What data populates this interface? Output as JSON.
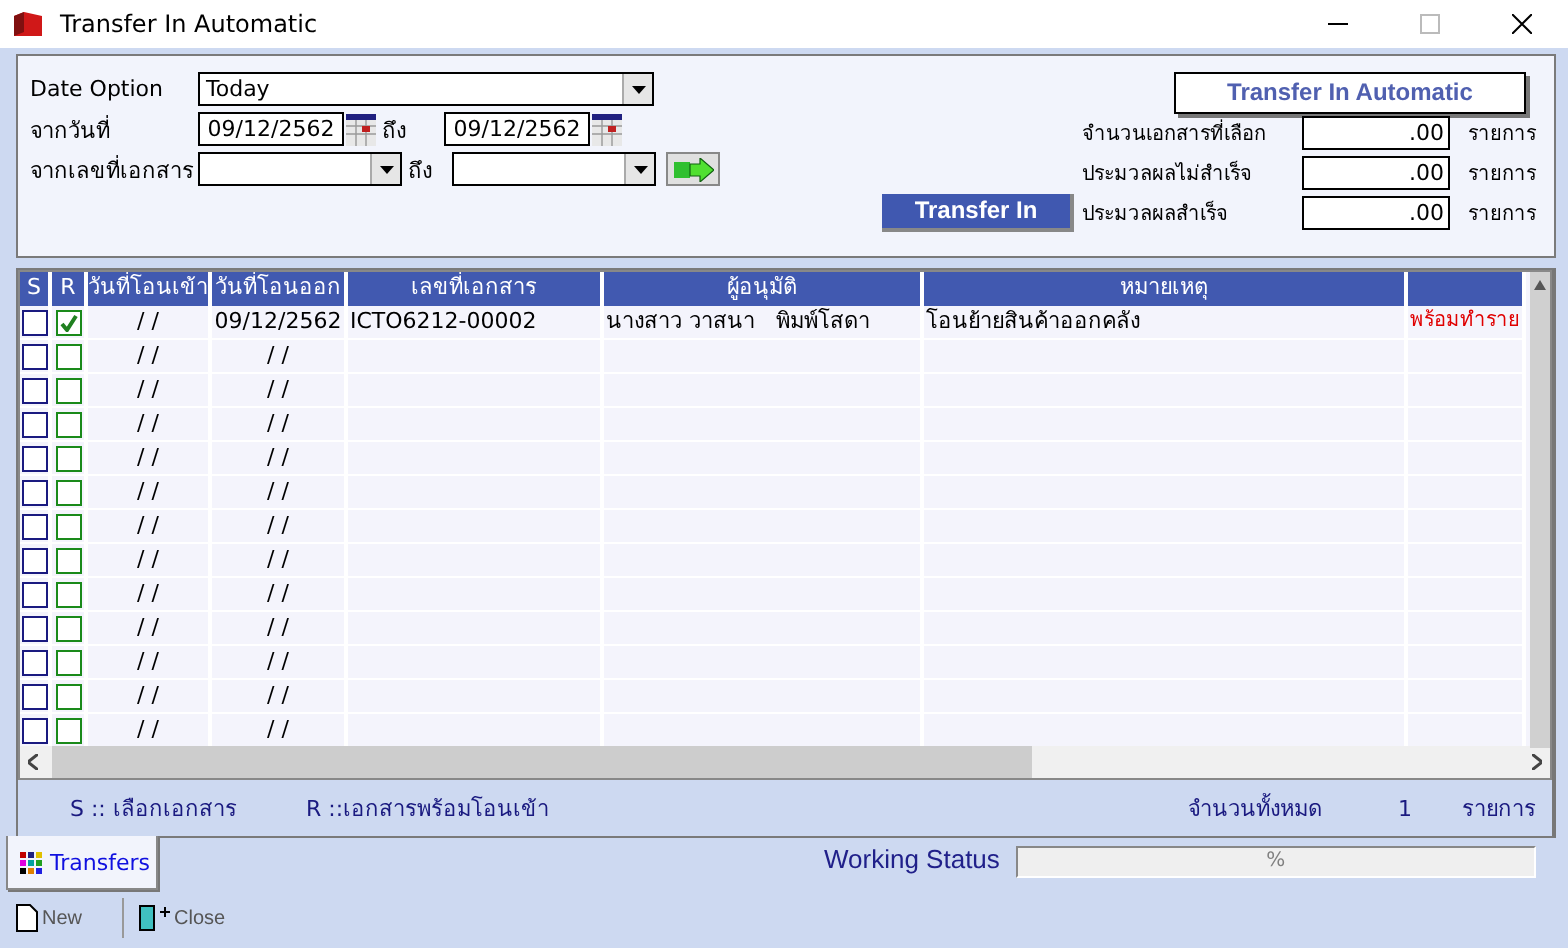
{
  "window": {
    "title": "Transfer In Automatic"
  },
  "filters": {
    "date_option": {
      "label": "Date Option",
      "value": "Today"
    },
    "date_range": {
      "label": "จากวันที่",
      "from": "09/12/2562",
      "to_label": "ถึง",
      "to": "09/12/2562"
    },
    "doc_range": {
      "label": "จากเลขที่เอกสาร",
      "to_label": "ถึง"
    }
  },
  "actions": {
    "auto_button": "Transfer In Automatic",
    "transfer_button": "Transfer In"
  },
  "summary": [
    {
      "label": "จำนวนเอกสารที่เลือก",
      "value": ".00",
      "unit": "รายการ"
    },
    {
      "label": "ประมวลผลไม่สำเร็จ",
      "value": ".00",
      "unit": "รายการ"
    },
    {
      "label": "ประมวลผลสำเร็จ",
      "value": ".00",
      "unit": "รายการ"
    }
  ],
  "table": {
    "columns": [
      "S",
      "R",
      "วันที่โอนเข้า",
      "วันที่โอนออก",
      "เลขที่เอกสาร",
      "ผู้อนุมัติ",
      "หมายเหตุ"
    ],
    "rows": [
      {
        "s": false,
        "r": true,
        "date_in": "/ /",
        "date_out": "09/12/2562",
        "doc_no": "ICTO6212-00002",
        "approver": "นางสาว วาสนา   พิมพ์โสดา",
        "note": "โอนย้ายสินค้าออกคลัง",
        "column_8": "พร้อมทำราย"
      },
      {
        "s": false,
        "r": false,
        "date_in": "/ /",
        "date_out": "/ /"
      },
      {
        "s": false,
        "r": false,
        "date_in": "/ /",
        "date_out": "/ /"
      },
      {
        "s": false,
        "r": false,
        "date_in": "/ /",
        "date_out": "/ /"
      },
      {
        "s": false,
        "r": false,
        "date_in": "/ /",
        "date_out": "/ /"
      },
      {
        "s": false,
        "r": false,
        "date_in": "/ /",
        "date_out": "/ /"
      },
      {
        "s": false,
        "r": false,
        "date_in": "/ /",
        "date_out": "/ /"
      },
      {
        "s": false,
        "r": false,
        "date_in": "/ /",
        "date_out": "/ /"
      },
      {
        "s": false,
        "r": false,
        "date_in": "/ /",
        "date_out": "/ /"
      },
      {
        "s": false,
        "r": false,
        "date_in": "/ /",
        "date_out": "/ /"
      },
      {
        "s": false,
        "r": false,
        "date_in": "/ /",
        "date_out": "/ /"
      },
      {
        "s": false,
        "r": false,
        "date_in": "/ /",
        "date_out": "/ /"
      },
      {
        "s": false,
        "r": false,
        "date_in": "/ /",
        "date_out": "/ /"
      }
    ]
  },
  "legend": [
    "S :: เลือกเอกสาร",
    "R ::เอกสารพร้อมโอนเข้า"
  ],
  "total": {
    "label": "จำนวนทั้งหมด",
    "value": "1",
    "unit": "รายการ"
  },
  "tabs": [
    {
      "label": "Transfers",
      "selected": true
    }
  ],
  "working_status": {
    "label": "Working Status",
    "level": 0,
    "text": "%"
  },
  "toolbar": [
    {
      "label": "New",
      "kind": "new"
    },
    {
      "label": "Close",
      "kind": "close"
    }
  ]
}
